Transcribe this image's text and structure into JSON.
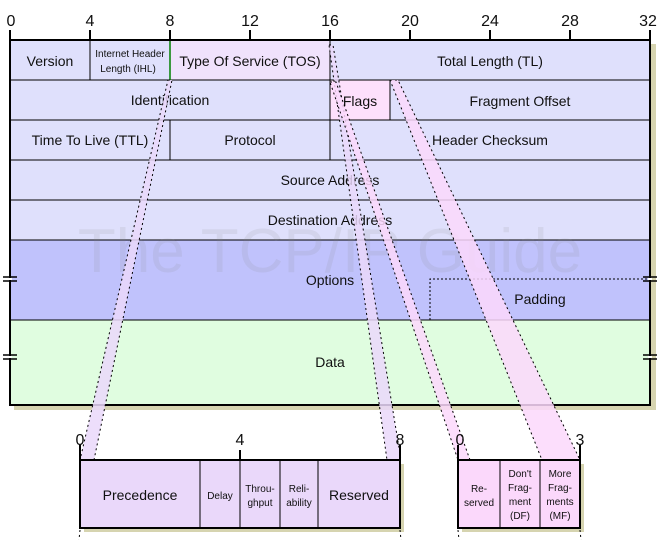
{
  "watermark": "The TCP/IP Guide",
  "colors": {
    "header": "#dfe0fc",
    "tos": "#f0e2fc",
    "flags": "#fde0fc",
    "options": "#c0c2fc",
    "data": "#e0fde0",
    "shadow": "#d6d4b0"
  },
  "ruler": [
    "0",
    "4",
    "8",
    "12",
    "16",
    "20",
    "24",
    "28",
    "32"
  ],
  "fields": {
    "version": "Version",
    "ihl_line1": "Internet Header",
    "ihl_line2": "Length (IHL)",
    "tos": "Type Of Service (TOS)",
    "total_length": "Total Length (TL)",
    "identification": "Identification",
    "flags": "Flags",
    "fragment_offset": "Fragment Offset",
    "ttl": "Time To Live (TTL)",
    "protocol": "Protocol",
    "header_checksum": "Header Checksum",
    "source_address": "Source Address",
    "destination_address": "Destination Address",
    "options": "Options",
    "padding": "Padding",
    "data": "Data"
  },
  "tos_detail": {
    "ruler": [
      "0",
      "4",
      "8"
    ],
    "precedence": "Precedence",
    "delay": "Delay",
    "throughput": [
      "Throu-",
      "ghput"
    ],
    "reliability": [
      "Reli-",
      "ability"
    ],
    "reserved": "Reserved"
  },
  "flags_detail": {
    "ruler": [
      "0",
      "3"
    ],
    "reserved": [
      "Re-",
      "served"
    ],
    "dont_fragment": [
      "Don't",
      "Frag-",
      "ment",
      "(DF)"
    ],
    "more_fragments": [
      "More",
      "Frag-",
      "ments",
      "(MF)"
    ]
  }
}
